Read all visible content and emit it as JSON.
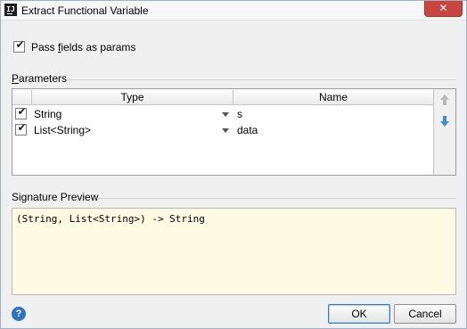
{
  "window": {
    "title": "Extract Functional Variable",
    "app_icon_text": "IJ",
    "close_glyph": "✕"
  },
  "options": {
    "pass_fields_checked": true,
    "pass_fields_label_pre": "Pass ",
    "pass_fields_label_mnemonic": "f",
    "pass_fields_label_post": "ields as params"
  },
  "parameters": {
    "section_mnemonic": "P",
    "section_rest": "arameters",
    "columns": [
      "Type",
      "Name"
    ],
    "rows": [
      {
        "checked": true,
        "type": "String",
        "name": "s"
      },
      {
        "checked": true,
        "type": "List<String>",
        "name": "data"
      }
    ],
    "move_up_icon": "arrow-up-icon",
    "move_down_icon": "arrow-down-icon"
  },
  "signature": {
    "section_title": "Signature Preview",
    "text": "(String, List<String>) -> String"
  },
  "footer": {
    "help_glyph": "?",
    "ok_label": "OK",
    "cancel_label": "Cancel"
  },
  "colors": {
    "preview_bg": "#fefbe2",
    "help_blue": "#2a73c7",
    "close_red": "#c8463f",
    "arrow_up_disabled": "#b8b8b8",
    "arrow_down_active": "#3b8fd6"
  }
}
